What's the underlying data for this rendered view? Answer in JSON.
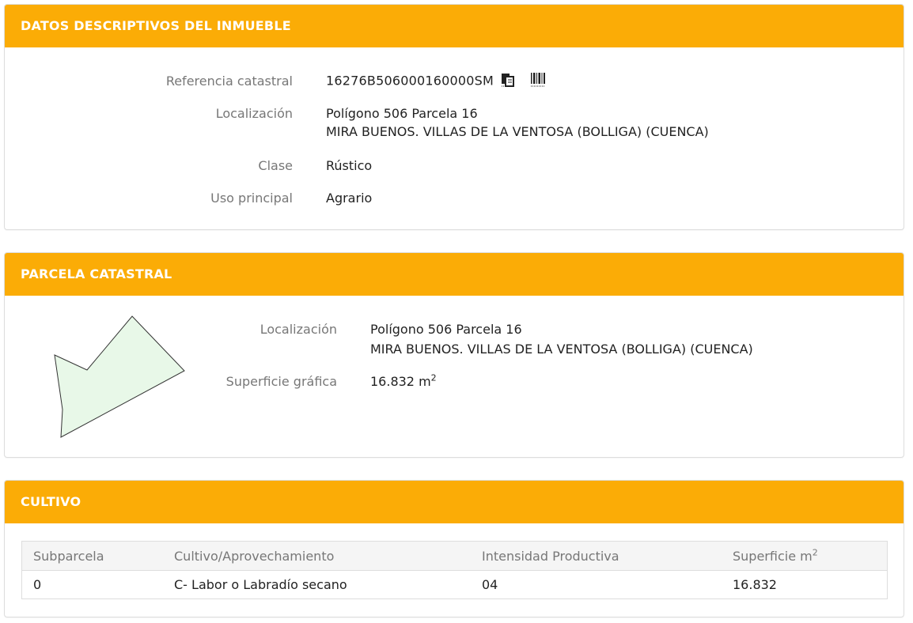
{
  "datos": {
    "title": "DATOS DESCRIPTIVOS DEL INMUEBLE",
    "ref_label": "Referencia catastral",
    "ref_value": "16276B506000160000SM",
    "loc_label": "Localización",
    "loc_line1": "Polígono 506 Parcela 16",
    "loc_line2": "MIRA BUENOS. VILLAS DE LA VENTOSA (BOLLIGA) (CUENCA)",
    "clase_label": "Clase",
    "clase_value": "Rústico",
    "uso_label": "Uso principal",
    "uso_value": "Agrario",
    "copy_icon": "copy-icon",
    "barcode_icon": "barcode-icon"
  },
  "parcela": {
    "title": "PARCELA CATASTRAL",
    "loc_label": "Localización",
    "loc_line1": "Polígono 506 Parcela 16",
    "loc_line2": "MIRA BUENOS. VILLAS DE LA VENTOSA (BOLLIGA) (CUENCA)",
    "sup_label": "Superficie gráfica",
    "sup_value": "16.832 m",
    "sup_unit_exp": "2",
    "shape_fill": "#e8f8e8",
    "shape_stroke": "#333333"
  },
  "cultivo": {
    "title": "CULTIVO",
    "headers": [
      "Subparcela",
      "Cultivo/Aprovechamiento",
      "Intensidad Productiva",
      "Superficie m"
    ],
    "header_exp": "2",
    "rows": [
      [
        "0",
        "C- Labor o Labradío secano",
        "04",
        "16.832"
      ]
    ]
  },
  "colors": {
    "accent": "#fbac06",
    "label": "#777777",
    "value": "#222222"
  }
}
